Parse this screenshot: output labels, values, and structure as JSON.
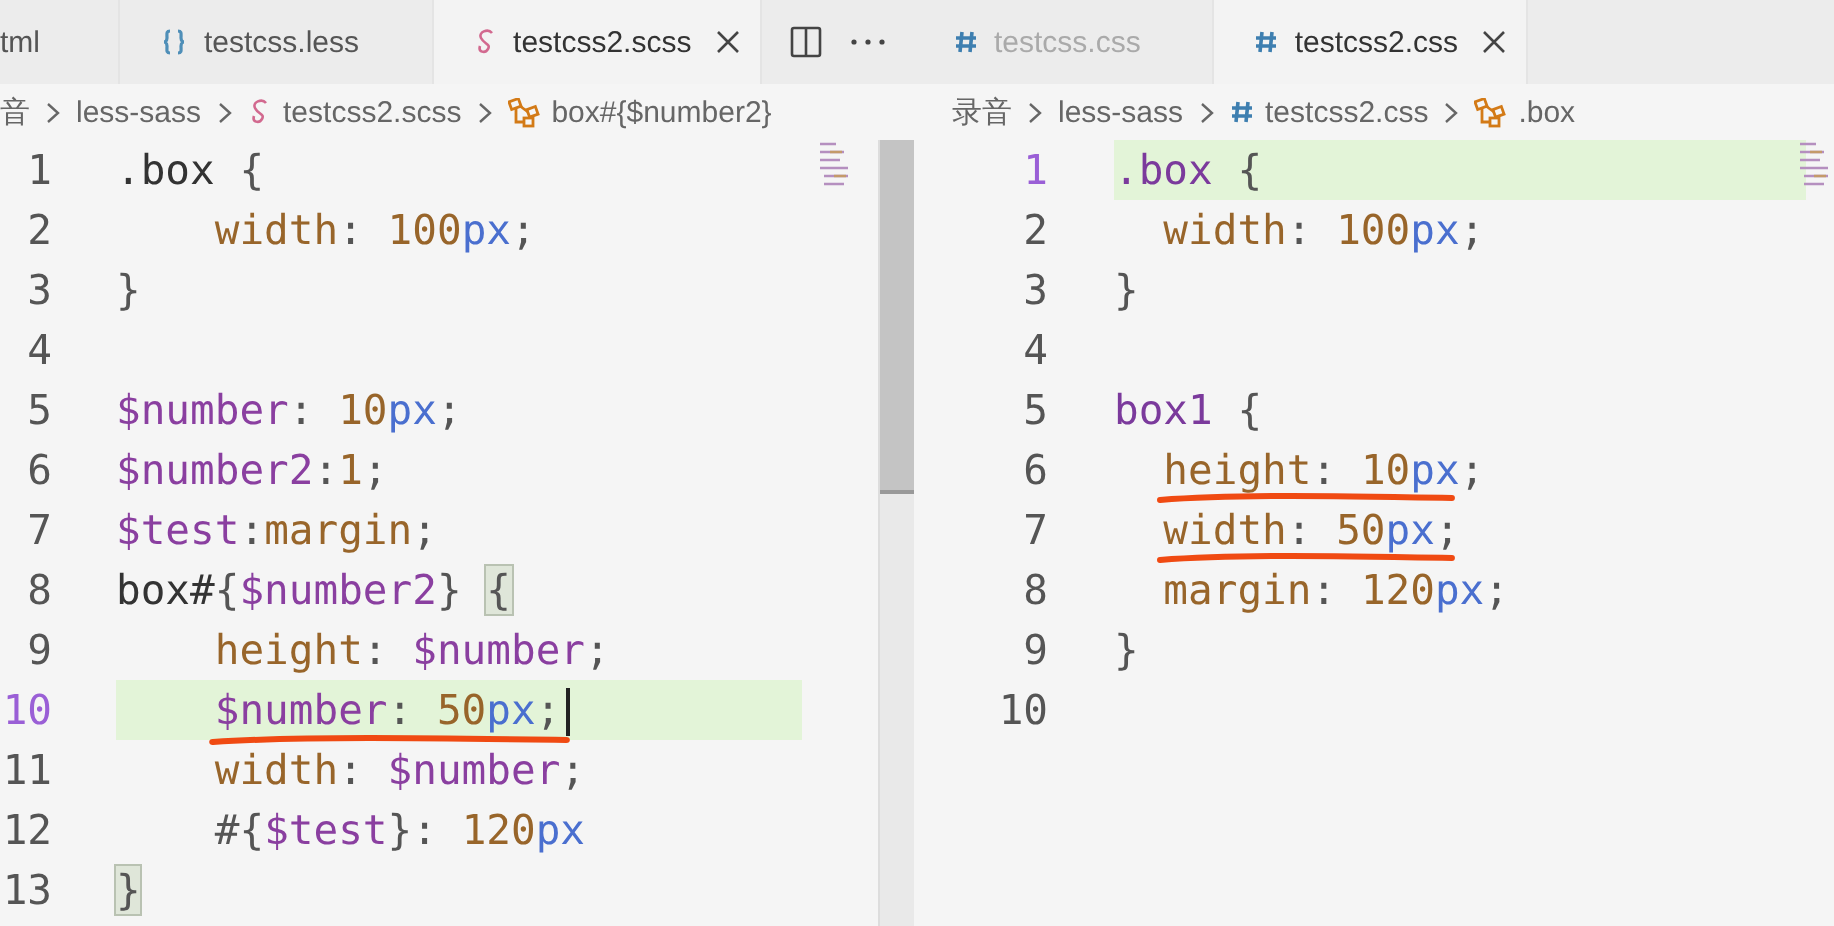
{
  "panes": [
    {
      "kind": "scss",
      "tabs": [
        {
          "label": "tml",
          "kind": "html",
          "selected": false,
          "dimmed": false
        },
        {
          "label": "testcss.less",
          "kind": "less",
          "selected": false,
          "dimmed": false
        },
        {
          "label": "testcss2.scss",
          "kind": "scss",
          "selected": true,
          "dimmed": false
        }
      ],
      "actions": true,
      "breadcrumb": [
        {
          "label": "音",
          "kind": "folder"
        },
        {
          "label": "less-sass",
          "kind": "folder"
        },
        {
          "label": "testcss2.scss",
          "kind": "scss"
        },
        {
          "label": "box#{$number2}",
          "kind": "symbol"
        }
      ],
      "lines": [
        {
          "number": "1",
          "tokens": [
            {
              "kind": "selector",
              "text": ".box"
            },
            {
              "kind": "punct",
              "text": " {"
            }
          ]
        },
        {
          "number": "2",
          "tokens": [
            {
              "kind": "prop",
              "text": "    width"
            },
            {
              "kind": "punct",
              "text": ": "
            },
            {
              "kind": "num",
              "text": "100"
            },
            {
              "kind": "unit",
              "text": "px"
            },
            {
              "kind": "punct",
              "text": ";"
            }
          ]
        },
        {
          "number": "3",
          "tokens": [
            {
              "kind": "punct",
              "text": "}"
            }
          ]
        },
        {
          "number": "4"
        },
        {
          "number": "5",
          "tokens": [
            {
              "kind": "var",
              "text": "$number"
            },
            {
              "kind": "punct",
              "text": ": "
            },
            {
              "kind": "num",
              "text": "10"
            },
            {
              "kind": "unit",
              "text": "px"
            },
            {
              "kind": "punct",
              "text": ";"
            }
          ]
        },
        {
          "number": "6",
          "tokens": [
            {
              "kind": "var",
              "text": "$number2"
            },
            {
              "kind": "punct",
              "text": ":"
            },
            {
              "kind": "num",
              "text": "1"
            },
            {
              "kind": "punct",
              "text": ";"
            }
          ]
        },
        {
          "number": "7",
          "tokens": [
            {
              "kind": "var",
              "text": "$test"
            },
            {
              "kind": "punct",
              "text": ":"
            },
            {
              "kind": "num",
              "text": "margin"
            },
            {
              "kind": "punct",
              "text": ";"
            }
          ]
        },
        {
          "number": "8",
          "tokens": [
            {
              "kind": "selector",
              "text": "box#"
            },
            {
              "kind": "punct",
              "text": "{"
            },
            {
              "kind": "var",
              "text": "$number2"
            },
            {
              "kind": "punct",
              "text": "} "
            },
            {
              "kind": "punct",
              "text": "{",
              "matched": true
            }
          ]
        },
        {
          "number": "9",
          "tokens": [
            {
              "kind": "prop",
              "text": "    height"
            },
            {
              "kind": "punct",
              "text": ": "
            },
            {
              "kind": "var",
              "text": "$number"
            },
            {
              "kind": "punct",
              "text": ";"
            }
          ]
        },
        {
          "number": "10",
          "current": true,
          "underlined": true,
          "cursor": true,
          "tokens": [
            {
              "kind": "var",
              "text": "    $number"
            },
            {
              "kind": "punct",
              "text": ": "
            },
            {
              "kind": "num",
              "text": "50"
            },
            {
              "kind": "unit",
              "text": "px"
            },
            {
              "kind": "punct",
              "text": ";"
            }
          ]
        },
        {
          "number": "11",
          "tokens": [
            {
              "kind": "prop",
              "text": "    width"
            },
            {
              "kind": "punct",
              "text": ": "
            },
            {
              "kind": "var",
              "text": "$number"
            },
            {
              "kind": "punct",
              "text": ";"
            }
          ]
        },
        {
          "number": "12",
          "tokens": [
            {
              "kind": "punct",
              "text": "    #{"
            },
            {
              "kind": "var",
              "text": "$test"
            },
            {
              "kind": "punct",
              "text": "}: "
            },
            {
              "kind": "num",
              "text": "120"
            },
            {
              "kind": "unit",
              "text": "px"
            }
          ]
        },
        {
          "number": "13",
          "tokens": [
            {
              "kind": "punct",
              "text": "}",
              "matched": true
            }
          ]
        }
      ]
    },
    {
      "kind": "css",
      "tabs": [
        {
          "label": "testcss.css",
          "kind": "css",
          "selected": false,
          "dimmed": true
        },
        {
          "label": "testcss2.css",
          "kind": "css",
          "selected": true,
          "dimmed": false
        }
      ],
      "actions": false,
      "breadcrumb": [
        {
          "label": "录音",
          "kind": "folder"
        },
        {
          "label": "less-sass",
          "kind": "folder"
        },
        {
          "label": "testcss2.css",
          "kind": "css"
        },
        {
          "label": ".box",
          "kind": "symbol"
        }
      ],
      "lines": [
        {
          "number": "1",
          "current": true,
          "tokens": [
            {
              "kind": "tag",
              "text": ".box"
            },
            {
              "kind": "punct",
              "text": " {"
            }
          ]
        },
        {
          "number": "2",
          "tokens": [
            {
              "kind": "prop",
              "text": "  width"
            },
            {
              "kind": "punct",
              "text": ": "
            },
            {
              "kind": "num",
              "text": "100"
            },
            {
              "kind": "unit",
              "text": "px"
            },
            {
              "kind": "punct",
              "text": ";"
            }
          ]
        },
        {
          "number": "3",
          "tokens": [
            {
              "kind": "punct",
              "text": "}"
            }
          ]
        },
        {
          "number": "4"
        },
        {
          "number": "5",
          "tokens": [
            {
              "kind": "tag",
              "text": "box1"
            },
            {
              "kind": "punct",
              "text": " {"
            }
          ]
        },
        {
          "number": "6",
          "underlined": true,
          "tokens": [
            {
              "kind": "prop",
              "text": "  height"
            },
            {
              "kind": "punct",
              "text": ": "
            },
            {
              "kind": "num",
              "text": "10"
            },
            {
              "kind": "unit",
              "text": "px"
            },
            {
              "kind": "punct",
              "text": ";"
            }
          ]
        },
        {
          "number": "7",
          "underlined": true,
          "tokens": [
            {
              "kind": "prop",
              "text": "  width"
            },
            {
              "kind": "punct",
              "text": ": "
            },
            {
              "kind": "num",
              "text": "50"
            },
            {
              "kind": "unit",
              "text": "px"
            },
            {
              "kind": "punct",
              "text": ";"
            }
          ]
        },
        {
          "number": "8",
          "tokens": [
            {
              "kind": "prop",
              "text": "  margin"
            },
            {
              "kind": "punct",
              "text": ": "
            },
            {
              "kind": "num",
              "text": "120"
            },
            {
              "kind": "unit",
              "text": "px"
            },
            {
              "kind": "punct",
              "text": ";"
            }
          ]
        },
        {
          "number": "9",
          "tokens": [
            {
              "kind": "punct",
              "text": "}"
            }
          ]
        },
        {
          "number": "10"
        }
      ]
    }
  ]
}
